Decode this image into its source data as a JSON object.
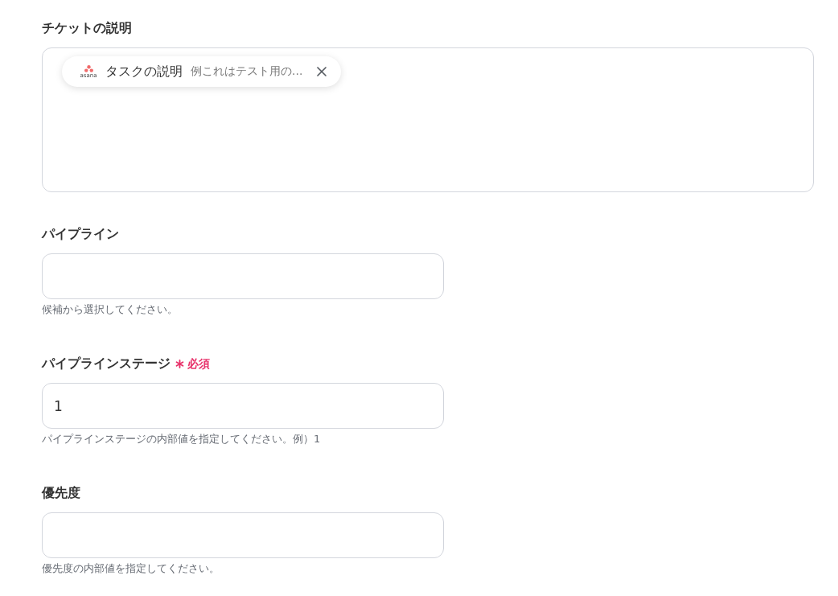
{
  "fields": [
    {
      "kind": "token_area",
      "label": "チケットの説明",
      "required": false,
      "tokens": [
        {
          "logo_text": "asana",
          "label": "タスクの説明",
          "preview": "例これはテスト用の..."
        }
      ]
    },
    {
      "kind": "text_input",
      "label": "パイプライン",
      "required": false,
      "helper": "候補から選択してください。"
    },
    {
      "kind": "text_input",
      "label": "パイプラインステージ",
      "required": true,
      "required_label": "必須",
      "value": "1",
      "helper": "パイプラインステージの内部値を指定してください。例）1"
    },
    {
      "kind": "text_input",
      "label": "優先度",
      "required": false,
      "helper": "優先度の内部値を指定してください。"
    }
  ]
}
